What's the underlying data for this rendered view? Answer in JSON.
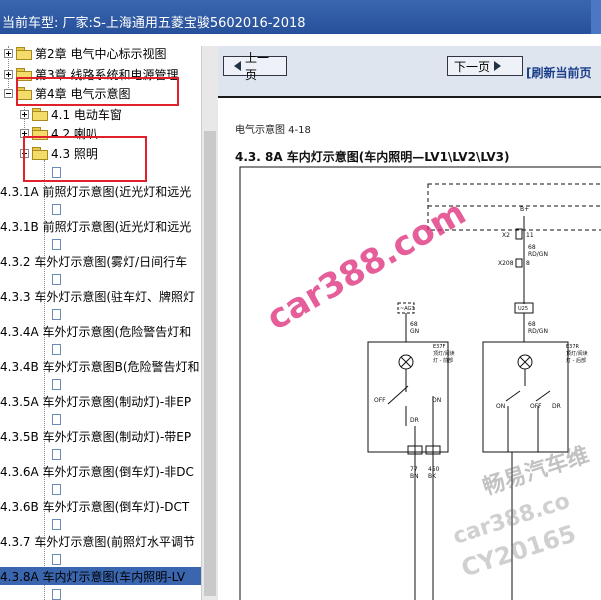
{
  "titlebar": {
    "text": "当前车型:  厂家:S-上海通用五菱宝骏5602016-2018"
  },
  "tree": {
    "items": [
      {
        "label": "第2章 电气中心标示视图"
      },
      {
        "label": "第3章 线路系统和电源管理"
      },
      {
        "label": "第4章 电气示意图"
      },
      {
        "label": "4.1 电动车窗"
      },
      {
        "label": "4.2 喇叭"
      },
      {
        "label": "4.3 照明"
      },
      {
        "label": "4.3.1A 前照灯示意图(近光灯和远光"
      },
      {
        "label": "4.3.1B 前照灯示意图(近光灯和远光"
      },
      {
        "label": "4.3.2 车外灯示意图(雾灯/日间行车"
      },
      {
        "label": "4.3.3 车外灯示意图(驻车灯、牌照灯"
      },
      {
        "label": "4.3.4A 车外灯示意图(危险警告灯和"
      },
      {
        "label": "4.3.4B 车外灯示意图B(危险警告灯和"
      },
      {
        "label": "4.3.5A 车外灯示意图(制动灯)-非EP"
      },
      {
        "label": "4.3.5B 车外灯示意图(制动灯)-带EP"
      },
      {
        "label": "4.3.6A 车外灯示意图(倒车灯)-非DC"
      },
      {
        "label": "4.3.6B 车外灯示意图(倒车灯)-DCT"
      },
      {
        "label": "4.3.7 车外灯示意图(前照灯水平调节"
      },
      {
        "label": "4.3.8A 车内灯示意图(车内照明-LV"
      }
    ]
  },
  "nav": {
    "prev_label": "上一页",
    "next_label": "下一页",
    "refresh_label": "[刷新当前页"
  },
  "diagram": {
    "page_title": "电气示意图 4-18",
    "title": "4.3. 8A 车内灯示意图(车内照明—LV1\\LV2\\LV3)",
    "labels": {
      "b_plus": "B+",
      "x2": "X2",
      "x2_pin": "11",
      "w68_rdgn": "68\nRD/GN",
      "x208": "X208",
      "x208_pin": "8",
      "u25": "U25",
      "w68b": "68\nRD/GN",
      "left_conn": "~AG3",
      "left_wire": "68\nGN",
      "e37f": "E37F\n顶灯/阅读\n灯 - 前部",
      "e37r": "E37R\n顶灯/阅读\n灯 - 后部",
      "off": "OFF",
      "on": "ON",
      "dr": "DR",
      "on2": "ON",
      "off2": "OFF",
      "dr2": "DR",
      "w77": "77\nBN",
      "w450": "450\nBK"
    }
  },
  "watermarks": {
    "main": "car388.com",
    "cn": "畅易汽车维",
    "cn2": "car388.co",
    "cy": "CY20165"
  },
  "colors": {
    "titlebar": "#3a66b0",
    "highlight_box": "#e0202a",
    "selected_row": "#3a66b0"
  }
}
